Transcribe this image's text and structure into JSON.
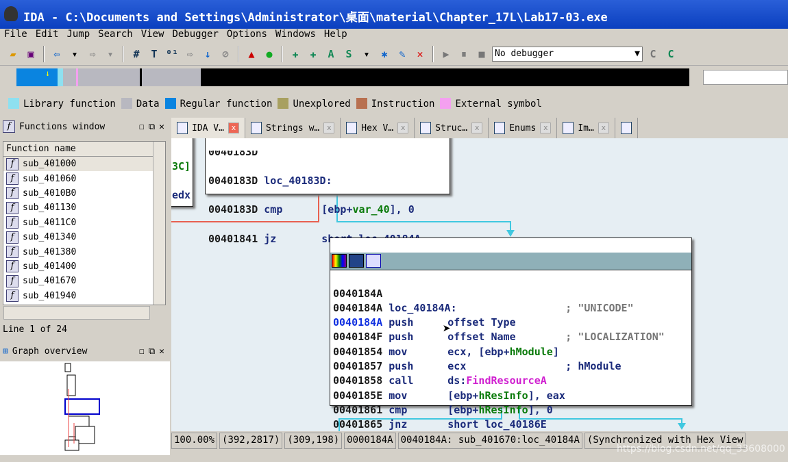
{
  "window": {
    "title": "IDA - C:\\Documents and Settings\\Administrator\\桌面\\material\\Chapter_17L\\Lab17-03.exe"
  },
  "menu": [
    "File",
    "Edit",
    "Jump",
    "Search",
    "View",
    "Debugger",
    "Options",
    "Windows",
    "Help"
  ],
  "toolbar": {
    "debugger_select": "No debugger"
  },
  "legend": [
    {
      "label": "Library function",
      "color": "#8ee0f0"
    },
    {
      "label": "Data",
      "color": "#b8b8c0"
    },
    {
      "label": "Regular function",
      "color": "#0a84e0"
    },
    {
      "label": "Unexplored",
      "color": "#a8a060"
    },
    {
      "label": "Instruction",
      "color": "#b87050"
    },
    {
      "label": "External symbol",
      "color": "#f4a0f0"
    }
  ],
  "tabs": [
    "IDA V…",
    "Strings w…",
    "Hex V…",
    "Struc…",
    "Enums",
    "Im…"
  ],
  "functions_window": {
    "title": "Functions window",
    "column": "Function name",
    "items": [
      "sub_401000",
      "sub_401060",
      "sub_4010B0",
      "sub_401130",
      "sub_4011C0",
      "sub_401340",
      "sub_401380",
      "sub_401400",
      "sub_401670",
      "sub_401940"
    ],
    "line_info": "Line 1 of 24"
  },
  "graph_overview": {
    "title": "Graph overview"
  },
  "block_top": {
    "lines": [
      {
        "addr": "0040183D",
        "text": "loc_40183D:"
      },
      {
        "addr": "0040183D",
        "mn": "cmp",
        "op": "[ebp+",
        "opv": "var_40",
        "op2": "], 0"
      },
      {
        "addr": "00401841",
        "mn": "jz",
        "op": "short loc_40184A"
      }
    ],
    "left_frag1": "3C]",
    "left_frag2": "edx"
  },
  "block_main": {
    "lines": [
      {
        "addr": "0040184A"
      },
      {
        "addr": "0040184A",
        "label": "loc_40184A:",
        "comment": "; \"UNICODE\""
      },
      {
        "addr": "0040184A",
        "mn": "push",
        "op": "offset Type"
      },
      {
        "addr": "0040184F",
        "mn": "push",
        "op": "offset Name",
        "comment": "; \"LOCALIZATION\""
      },
      {
        "addr": "00401854",
        "mn": "mov",
        "op": "ecx, [ebp+",
        "var": "hModule",
        "op2": "]"
      },
      {
        "addr": "00401857",
        "mn": "push",
        "op": "ecx",
        "comment": "; hModule"
      },
      {
        "addr": "00401858",
        "mn": "call",
        "op": "ds:",
        "api": "FindResourceA"
      },
      {
        "addr": "0040185E",
        "mn": "mov",
        "op": "[ebp+",
        "var": "hResInfo",
        "op2": "], eax"
      },
      {
        "addr": "00401861",
        "mn": "cmp",
        "op": "[ebp+",
        "var": "hResInfo",
        "op2": "], 0"
      },
      {
        "addr": "00401865",
        "mn": "jnz",
        "op": "short loc_40186E"
      }
    ]
  },
  "status": [
    "100.00%",
    "(392,2817)",
    "(309,198)",
    "0000184A",
    "0040184A: sub_401670:loc_40184A",
    "(Synchronized with Hex View"
  ],
  "watermark": "https://blog.csdn.net/qq_33608000"
}
